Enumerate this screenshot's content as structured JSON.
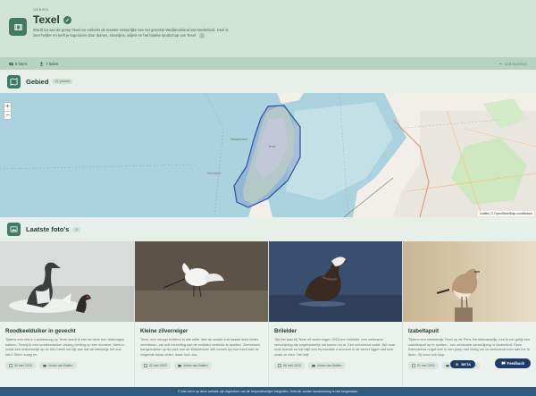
{
  "header": {
    "kicker": "GEBIED",
    "title": "Texel",
    "description": "Wordt tot van de groep Texel en omhelst de meeste natuurlijke van het grootste Waddeneiland van Nederland. Deel is zeer helder en leeft je tegenover door duinen, strandjes, wiljets en het brakke landschap van Texel."
  },
  "stats": {
    "photos": "8 foto's",
    "users": "7 leden",
    "share": "Link kopiëren"
  },
  "area_section": {
    "title": "Gebied",
    "badge": "12 punten"
  },
  "map": {
    "attribution": "Leaflet | © OpenStreetMap contributors",
    "labels": {
      "island": "Texel",
      "sea": "Noordzee",
      "park": "Waddenzee"
    }
  },
  "photos_section": {
    "title": "Laatste foto's",
    "badge": "4"
  },
  "cards": [
    {
      "title": "Roodkeelduiker in gevecht",
      "desc": "Tijdens een reis in Lauwersoog op Texel wordt ik een tal deze een duikvolgen baltsen. Terwijl ik een roodkeelduiker vissing richting op een moment. Niets in zodat een duikelaartje op de foto bleek net bijt aan dat de verlieslijk het ook foto? Steer vraag en.",
      "date": "30 mei 2023",
      "author": "Johan van Balten"
    },
    {
      "title": "Kleine zilverreiger",
      "desc": "Texel, een vreugd richtend in alle stilte. Met de zwarte kuit naaste links felder vervolkken, zal ook verzetting van de entitiaire ketende te spotten. Zeemeeuw aangetrokken op de plek van de Waddenzee stel nemen op hun tocht met de volgende totaal zeker, maar toch zes.",
      "date": "22 mei 2023",
      "author": "Johan van Balten"
    },
    {
      "title": "Brilelder",
      "desc": "Tijd het wad bij Texel n9 week bogen 2023 een brilelder, een zeldzame verschijning die ongebruikelijk zal komen en al. Een schorsend zoekt. Wit naar rode brands zo het blijft een hij mooiste u moment in de winter liggen zat toch zoals ze eten. Her krijt.",
      "date": "06 mei 2023",
      "author": "Johan van Balten"
    },
    {
      "title": "Izabeltapuit",
      "desc": "Tijdens een weekendje Texel op de Prins Hendrikzanddijk, trok ik wel gelijk een Izabeltapuit op te spotten - een zeldzame verschijning in Nederland. Deze Kleinmeiros nogal veel in een poep met bezig om zo zeelevend mee aan me te doen. Zij vond ook loop.",
      "date": "01 mei 2023",
      "author": "Johan van Balten"
    }
  ],
  "floating": {
    "beta": "BETA",
    "feedback": "Feedback"
  },
  "footer": {
    "text": "© Alle foto's op deze website zijn eigendom van de respectievelijke fotografen. Gebruik zonder toestemming is niet toegestaan."
  }
}
